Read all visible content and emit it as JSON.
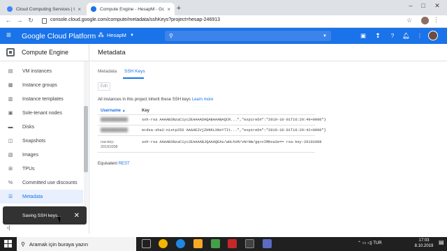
{
  "browser": {
    "tabs": [
      {
        "title": "Cloud Computing Services | Go",
        "close": "×"
      },
      {
        "title": "Compute Engine - HesapM - Goo",
        "close": "×"
      }
    ],
    "new_tab": "+",
    "url": "console.cloud.google.com/compute/metadata/sshKeys?project=hesap-246913",
    "window_controls": {
      "minimize": "–",
      "maximize": "□",
      "close": "✕"
    }
  },
  "gcp": {
    "menu_icon": "≡",
    "title": "Google Cloud Platform",
    "project": "HesapM",
    "search_icon": "🔍",
    "chevron": "▼"
  },
  "sidebar": {
    "title": "Compute Engine",
    "items": [
      {
        "label": "VM instances",
        "icon": "▤"
      },
      {
        "label": "Instance groups",
        "icon": "▦"
      },
      {
        "label": "Instance templates",
        "icon": "▥"
      },
      {
        "label": "Sole-tenant nodes",
        "icon": "▣"
      },
      {
        "label": "Disks",
        "icon": "▬"
      },
      {
        "label": "Snapshots",
        "icon": "◫"
      },
      {
        "label": "Images",
        "icon": "▧"
      },
      {
        "label": "TPUs",
        "icon": "⊞"
      },
      {
        "label": "Committed use discounts",
        "icon": "%"
      },
      {
        "label": "Metadata",
        "icon": "☰",
        "active": true
      }
    ],
    "collapse_icon": "‹|"
  },
  "main": {
    "title": "Metadata",
    "tabs": [
      "Metadata",
      "SSH Keys"
    ],
    "edit_label": "Edit",
    "info_text": "All instances in this project inherit these SSH keys",
    "learn_more": "Learn more",
    "table": {
      "headers": {
        "username": "Username",
        "sort_icon": "▲",
        "key": "Key"
      },
      "rows": [
        {
          "username": "██████████",
          "key": "ssh-rsa AAAAB3NzaC1yc2EAAAADAQABAAABAQCR...\",\"expireOn\":\"2019-10-01T16:29:49+0000\"}"
        },
        {
          "username": "██████████",
          "key": "ecdsa-sha2-nistp256 AAAAE2VjZHNhLXNoYTIt...\",\"expireOn\":\"2019-10-01T16:29:42+0000\"}"
        },
        {
          "username": "rsa-key-",
          "username2": "20191008",
          "key": "ssh-rsa AAAAB3NzaC1yc2EAAAABJQAAAQEAu/wHLhoM/vNrNm/gq+vIMNxaSe== rsa-key-20191008"
        }
      ]
    },
    "equivalent": "Equivalent",
    "rest": "REST"
  },
  "snackbar": {
    "text": "Saving SSH keys...",
    "close": "✕"
  },
  "taskbar": {
    "search_placeholder": "Aramak için buraya yazın",
    "search_icon": "⚲",
    "tray": "⌃  ▭  ◁)  TUR",
    "time": "17:03",
    "date": "8.10.2019",
    "notif": "▤"
  }
}
